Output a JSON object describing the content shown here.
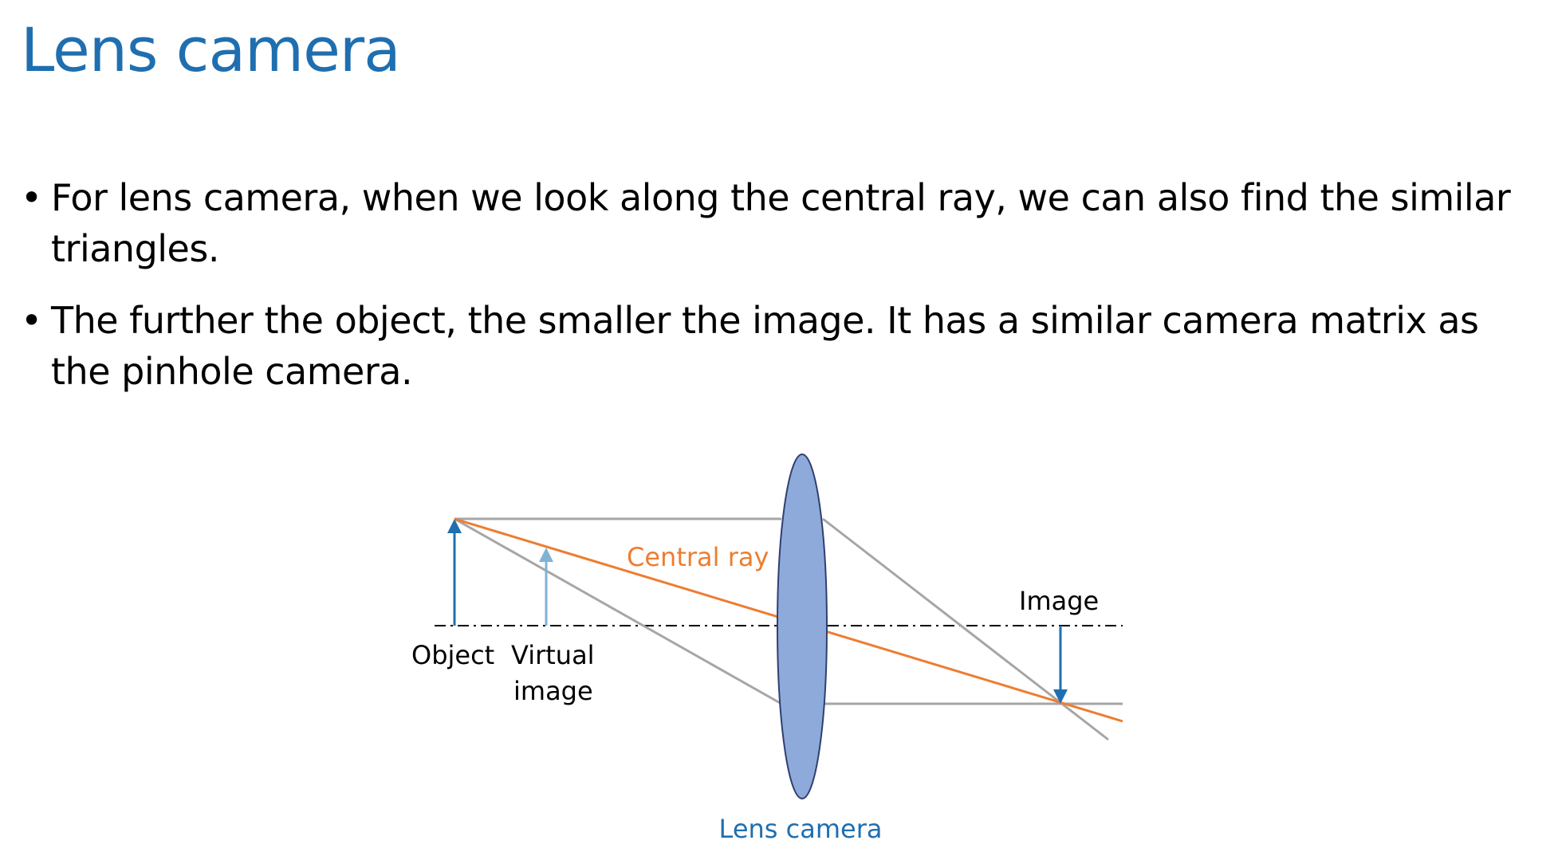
{
  "slide": {
    "title": "Lens camera",
    "bullets": [
      "For lens camera, when we look along the central ray, we can also find the similar triangles.",
      "The further the object, the smaller the image. It has a similar camera matrix as the pinhole camera."
    ],
    "bullet_symbol": "•"
  },
  "diagram": {
    "labels": {
      "central_ray": "Central ray",
      "image": "Image",
      "object": "Object",
      "virtual_image_line1": "Virtual",
      "virtual_image_line2": "image",
      "caption": "Lens camera"
    },
    "colors": {
      "title": "#1f6fb0",
      "central_ray": "#ed7d31",
      "rays": "#a6a6a6",
      "object_arrow": "#1f6fb0",
      "virtual_image_arrow": "#7fb3d5",
      "image_arrow": "#1f6fb0",
      "lens_fill": "#8eaadb",
      "lens_stroke": "#2f3f6f",
      "caption": "#1f6fb0"
    }
  }
}
